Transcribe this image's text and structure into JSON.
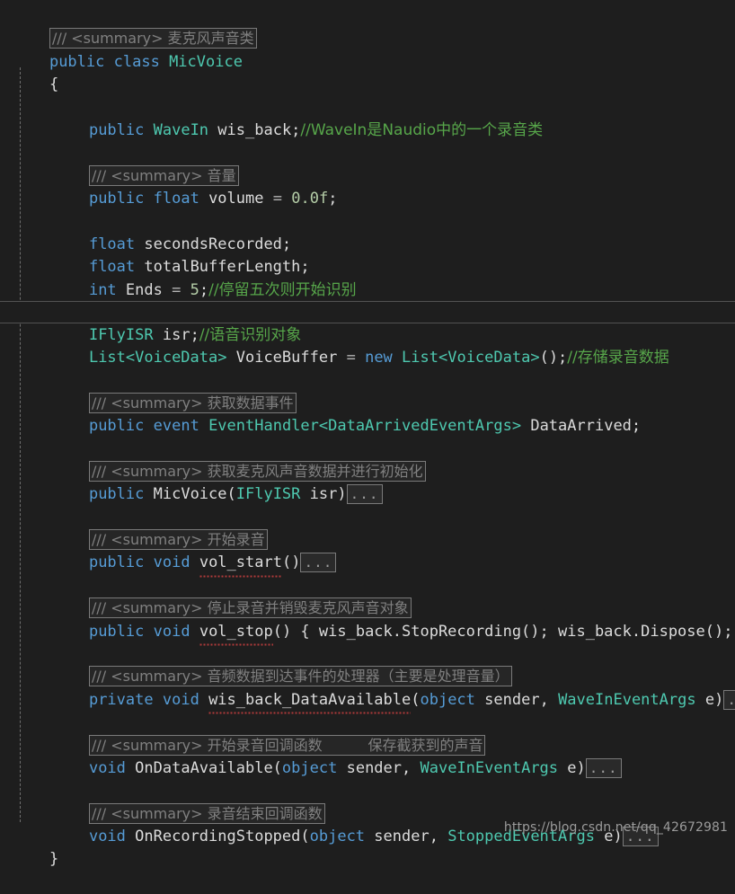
{
  "editor": {
    "language": "csharp",
    "theme": "visual-studio-dark",
    "background": "#1e1e1e",
    "colors": {
      "keyword": "#569cd6",
      "type": "#4ec9b0",
      "identifier": "#dcdcdc",
      "number": "#b5cea8",
      "comment": "#57a64a",
      "doc_comment": "#808080",
      "current_line_border": "#525252",
      "indent_guide": "#6e6e6e",
      "squiggle": "#b03a3a"
    }
  },
  "lines": {
    "l01_doc": "/// <summary> 麦克风声音类",
    "l02_kw_public": "public",
    "l02_kw_class": "class",
    "l02_type": "MicVoice",
    "l03_brace": "{",
    "l05_kw": "public",
    "l05_type": "WaveIn",
    "l05_id": "wis_back;",
    "l05_cmt": "//WaveIn是Naudio中的一个录音类",
    "l07_doc": "/// <summary> 音量",
    "l08_kw1": "public",
    "l08_kw2": "float",
    "l08_id": "volume",
    "l08_op": "=",
    "l08_num": "0.0f",
    "l08_semi": ";",
    "l10_kw": "float",
    "l10_id": "secondsRecorded;",
    "l11_kw": "float",
    "l11_id": "totalBufferLength;",
    "l12_kw": "int",
    "l12_id": "Ends",
    "l12_op": "=",
    "l12_num": "5",
    "l12_semi": ";",
    "l12_cmt": "//停留五次则开始识别",
    "l14_type": "IFlyISR",
    "l14_id": "isr;",
    "l14_cmt": "//语音识别对象",
    "l15_type1": "List<VoiceData>",
    "l15_id1": "VoiceBuffer",
    "l15_op": "=",
    "l15_kw": "new",
    "l15_type2": "List<VoiceData>",
    "l15_tail": "();",
    "l15_cmt": "//存储录音数据",
    "l17_doc": "/// <summary> 获取数据事件",
    "l18_kw1": "public",
    "l18_kw2": "event",
    "l18_type1": "EventHandler<",
    "l18_type2": "DataArrivedEventArgs",
    "l18_type3": ">",
    "l18_id": "DataArrived;",
    "l20_doc": "/// <summary> 获取麦克风声音数据并进行初始化",
    "l21_kw": "public",
    "l21_id": "MicVoice(",
    "l21_type": "IFlyISR",
    "l21_param": "isr)",
    "l21_ellipsis": "...",
    "l23_doc": "/// <summary> 开始录音",
    "l24_kw1": "public",
    "l24_kw2": "void",
    "l24_id": "vol_start",
    "l24_paren": "()",
    "l24_ellipsis": "...",
    "l26_doc": "/// <summary> 停止录音并销毁麦克风声音对象",
    "l27_kw1": "public",
    "l27_kw2": "void",
    "l27_id": "vol_stop",
    "l27_body": "() { wis_back.StopRecording(); wis_back.Dispose(); }",
    "l29_doc": "/// <summary> 音频数据到达事件的处理器（主要是处理音量）",
    "l30_kw1": "private",
    "l30_kw2": "void",
    "l30_id": "wis_back_DataAvailable",
    "l30_paren1": "(",
    "l30_kw3": "object",
    "l30_param1": "sender,",
    "l30_type": "WaveInEventArgs",
    "l30_param2": "e)",
    "l30_ellipsis": "...",
    "l32_doc": "/// <summary> 开始录音回调函数          保存截获到的声音",
    "l33_kw1": "void",
    "l33_id": "OnDataAvailable(",
    "l33_kw2": "object",
    "l33_param1": "sender,",
    "l33_type": "WaveInEventArgs",
    "l33_param2": "e)",
    "l33_ellipsis": "...",
    "l35_doc": "/// <summary> 录音结束回调函数",
    "l36_kw1": "void",
    "l36_id": "OnRecordingStopped(",
    "l36_kw2": "object",
    "l36_param1": "sender,",
    "l36_type": "StoppedEventArgs",
    "l36_param2": "e)",
    "l36_ellipsis": "...",
    "l37_brace": "}"
  },
  "watermark": {
    "url": "https://blog.csdn.net/qq_42672981"
  }
}
